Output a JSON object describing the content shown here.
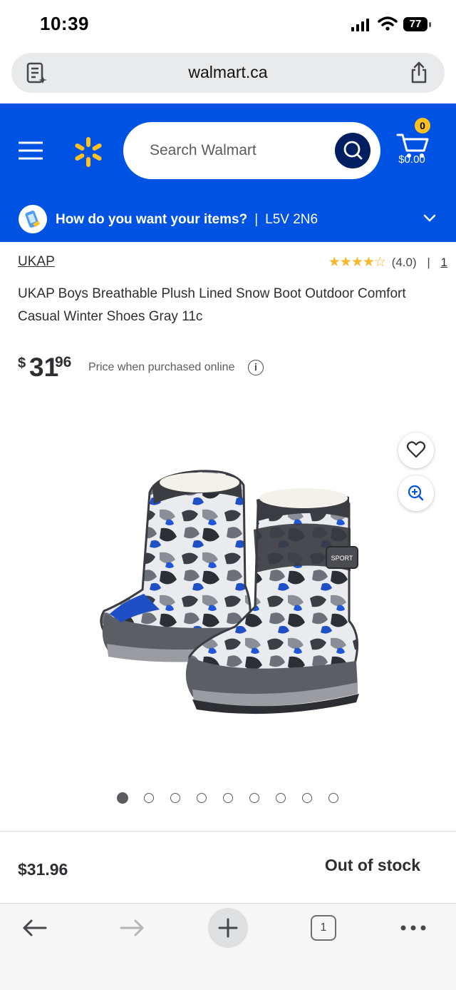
{
  "status_bar": {
    "time": "10:39",
    "battery": "77"
  },
  "browser": {
    "url": "walmart.ca",
    "tab_count": "1"
  },
  "header": {
    "search_placeholder": "Search Walmart",
    "cart_count": "0",
    "cart_total": "$0.00",
    "delivery_prompt": "How do you want your items?",
    "delivery_separator": "|",
    "postal_code": "L5V 2N6",
    "brand_color": "#0053e2",
    "spark_color": "#ffc220"
  },
  "product": {
    "brand": "UKAP",
    "rating_text": "(4.0)",
    "rating_value": 4.0,
    "rating_separator": "|",
    "review_count": "1",
    "title": "UKAP Boys Breathable Plush Lined Snow Boot Outdoor Comfort Casual Winter Shoes Gray 11c",
    "price_symbol": "$",
    "price_dollars": "31",
    "price_cents": "96",
    "price_note": "Price when purchased online",
    "image_count": 9,
    "active_image": 0,
    "boot_label": "SPORT"
  },
  "sticky_bar": {
    "price": "$31.96",
    "stock_status": "Out of stock"
  },
  "icons": {
    "address_left": "reader-icon",
    "share": "share-icon",
    "menu": "hamburger-menu-icon",
    "logo": "walmart-spark-icon",
    "search": "search-icon",
    "cart": "cart-icon",
    "delivery": "delivery-phone-icon",
    "chevron": "chevron-down-icon",
    "favorite": "heart-icon",
    "zoom": "zoom-in-icon",
    "info": "info-icon",
    "back": "back-arrow-icon",
    "forward": "forward-arrow-icon",
    "new_tab": "plus-icon",
    "more": "more-icon"
  }
}
